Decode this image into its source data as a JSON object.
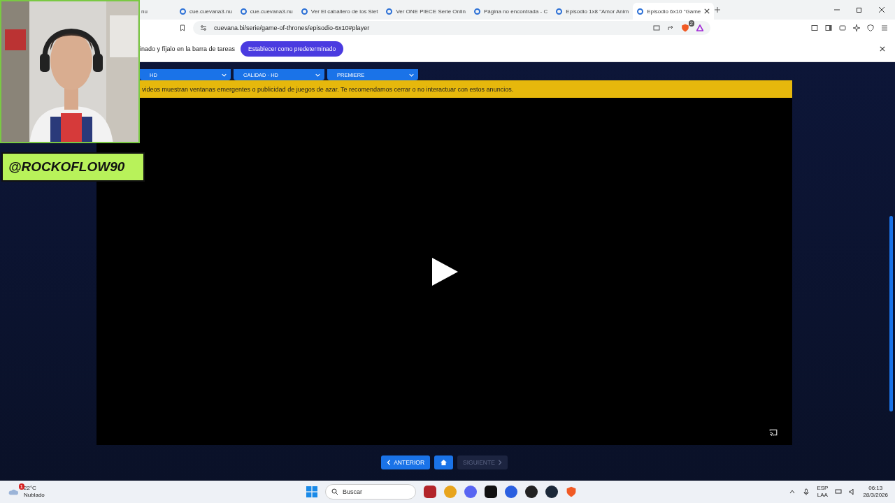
{
  "browser": {
    "tabs": [
      {
        "title": "nu",
        "selected": false
      },
      {
        "title": "cue.cuevana3.nu",
        "selected": false
      },
      {
        "title": "cue.cuevana3.nu",
        "selected": false
      },
      {
        "title": "Ver El caballero de los Siet",
        "selected": false
      },
      {
        "title": "Ver ONE PIECE Serie Onlin",
        "selected": false
      },
      {
        "title": "Página no encontrada - C",
        "selected": false
      },
      {
        "title": "Episodio 1x8 \"Amor Anim",
        "selected": false
      },
      {
        "title": "Episodio 6x10 \"Game",
        "selected": true
      }
    ],
    "url": "cuevana.bi/serie/game-of-thrones/episodio-6x10#player",
    "shields_count": "2"
  },
  "infobar": {
    "text": "inado y fíjalo en la barra de tareas",
    "button": "Establecer como predeterminado"
  },
  "servers": [
    {
      "detail": "HD"
    },
    {
      "detail": "CALIDAD · HD"
    },
    {
      "detail": "PREMIERE"
    }
  ],
  "warning": "videos muestran ventanas emergentes o publicidad de juegos de azar. Te recomendamos cerrar o no interactuar con estos anuncios.",
  "navigation": [
    {
      "kind": "prev",
      "label": "ANTERIOR",
      "disabled": false
    },
    {
      "kind": "home",
      "disabled": false
    },
    {
      "kind": "next",
      "label": "SIGUIENTE",
      "disabled": true
    }
  ],
  "overlay": {
    "handle": "@ROCKOFLOW90"
  },
  "taskbar": {
    "weather": {
      "temp": "22°C",
      "condition": "Nublado",
      "badge": "1"
    },
    "search": "Buscar",
    "lang": "ESP",
    "layout": "LAA",
    "time": "06:13",
    "date": "28/3/2026"
  }
}
